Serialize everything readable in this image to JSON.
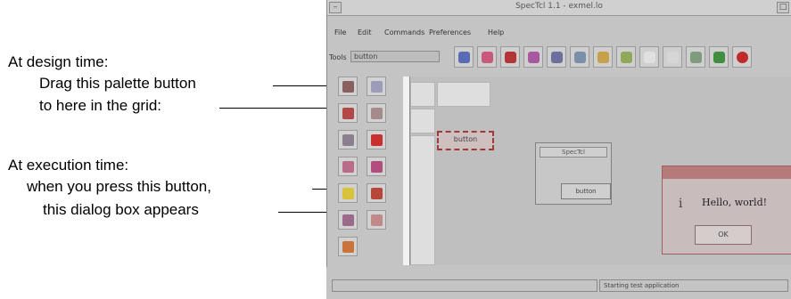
{
  "annotations": {
    "design_heading": "At design time:",
    "design_step1": "Drag this palette button",
    "design_step2": "to here in the grid:",
    "exec_heading": "At execution time:",
    "exec_step1": "when you press this button,",
    "exec_step2": "this dialog box appears"
  },
  "window": {
    "title": "SpecTcl 1.1 - exmel.lo",
    "menus": [
      "File",
      "Edit",
      "Commands",
      "Preferences",
      "Help"
    ],
    "tools_label": "Tools",
    "tools_value": "button",
    "toolbar_icons": [
      "frame-icon",
      "label-icon",
      "text-icon",
      "entry-icon",
      "scale-icon",
      "scrollbar-icon",
      "menubutton-icon",
      "radiobutton-icon",
      "checkbutton-icon",
      "listbox-icon",
      "canvas-icon",
      "test-icon",
      "stop-icon"
    ],
    "palette_icons": [
      "button-icon",
      "label-icon",
      "checkbutton-icon",
      "radiobutton-icon",
      "entry-icon",
      "message-icon",
      "listbox-icon",
      "scale-icon",
      "menubutton-icon",
      "canvas-icon",
      "scrollbar-icon",
      "frame-icon",
      "text-icon"
    ],
    "grid_button_label": "button",
    "status_message": "Starting test application"
  },
  "test_app": {
    "title": "SpecTcl",
    "button_label": "button"
  },
  "dialog": {
    "icon": "i",
    "message": "Hello, world!",
    "ok_label": "OK"
  },
  "colors": {
    "window_bg": "#c4c4c4",
    "dialog_bg": "#c9bcbc",
    "selection": "#a03a3a"
  }
}
